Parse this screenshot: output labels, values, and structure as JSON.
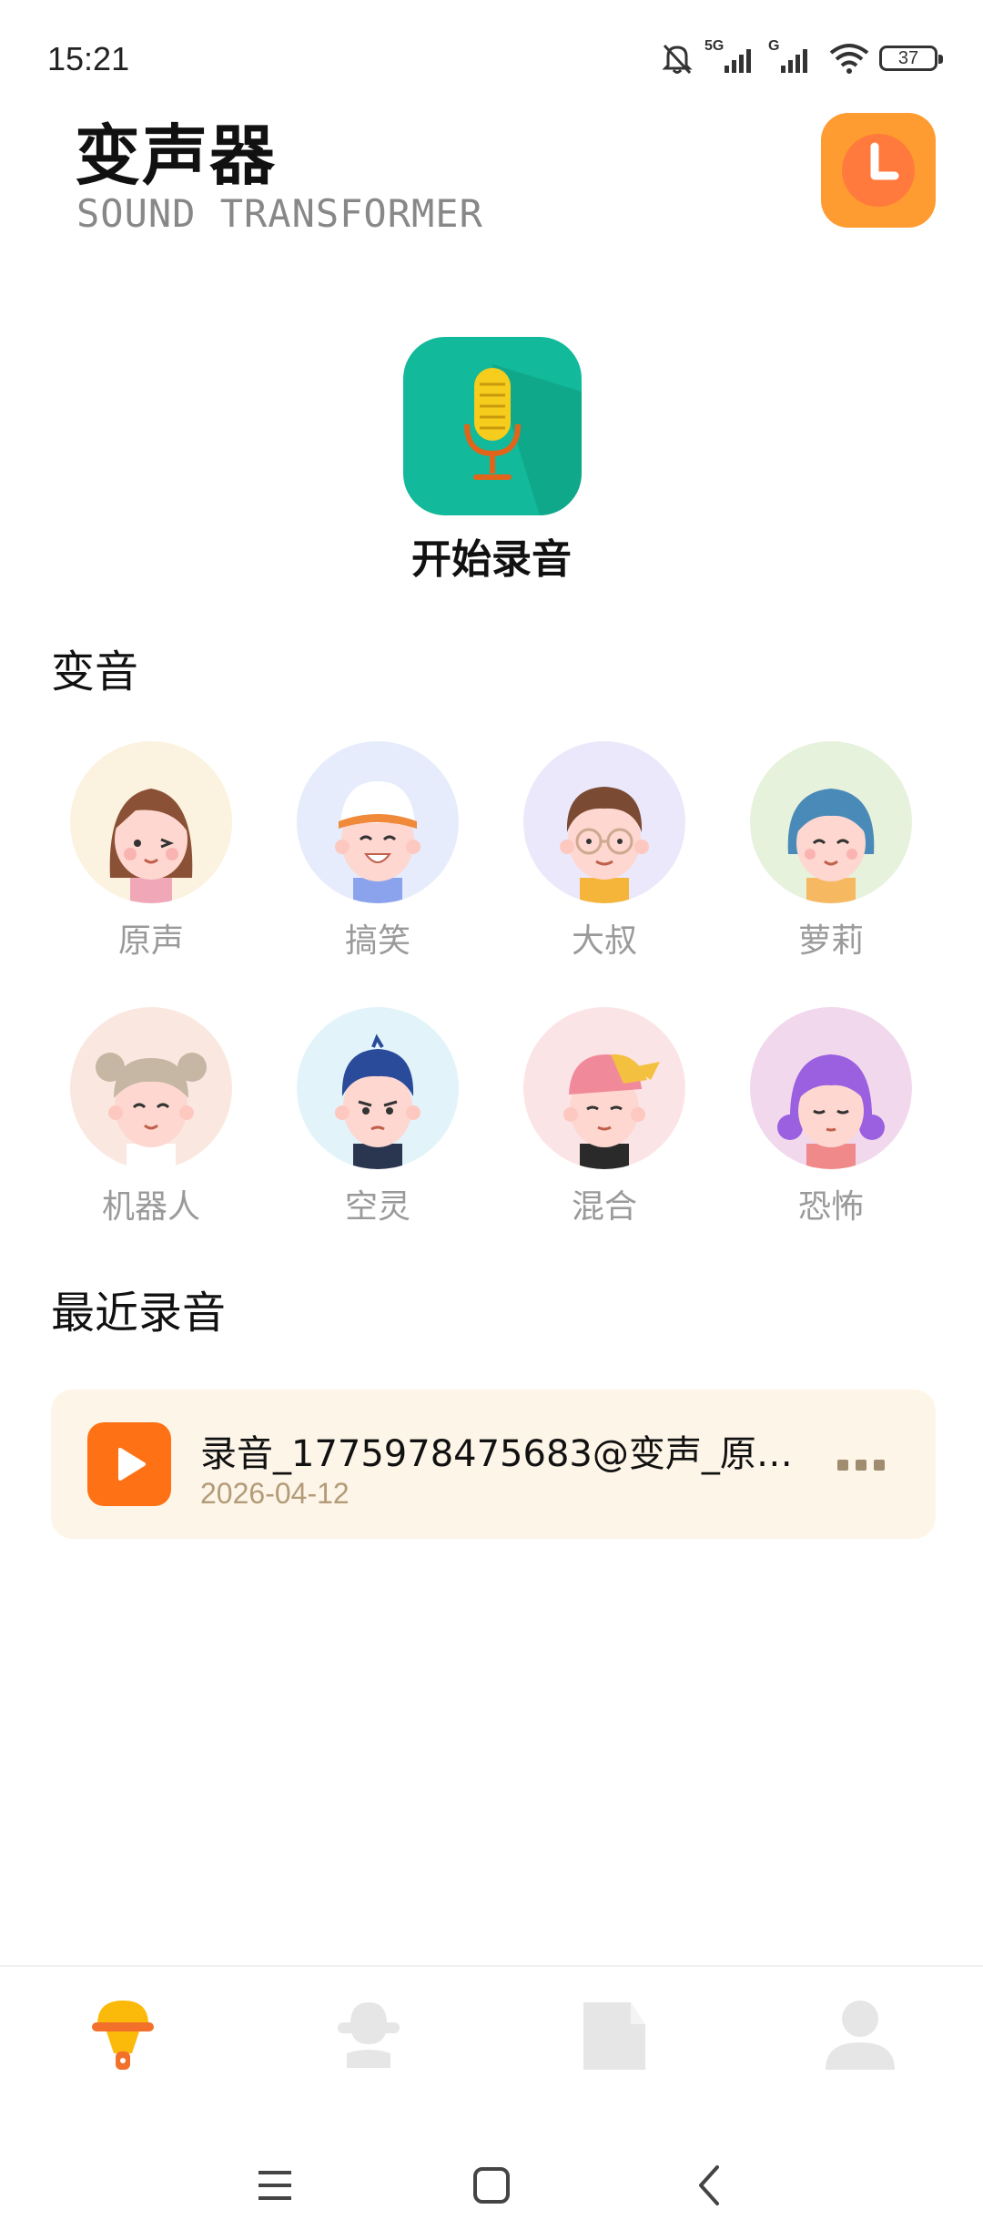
{
  "status_bar": {
    "time": "15:21",
    "signal1": "5G",
    "signal2": "G",
    "battery": "37"
  },
  "header": {
    "title": "变声器",
    "subtitle": "SOUND TRANSFORMER",
    "history_icon": "clock-icon"
  },
  "record": {
    "label": "开始录音",
    "icon": "microphone-icon"
  },
  "voices_section": {
    "title": "变音",
    "items": [
      {
        "label": "原声",
        "bg": "#fbf2df"
      },
      {
        "label": "搞笑",
        "bg": "#e6ecfb"
      },
      {
        "label": "大叔",
        "bg": "#ece8fb"
      },
      {
        "label": "萝莉",
        "bg": "#e6f2dc"
      },
      {
        "label": "机器人",
        "bg": "#fae8e0"
      },
      {
        "label": "空灵",
        "bg": "#e2f4fa"
      },
      {
        "label": "混合",
        "bg": "#fbe4e6"
      },
      {
        "label": "恐怖",
        "bg": "#f1d8ec"
      }
    ]
  },
  "recent_section": {
    "title": "最近录音",
    "items": [
      {
        "name": "录音_1775978475683@变声_原…",
        "date": "2026-04-12",
        "play_icon": "play-icon",
        "more_icon": "more-icon"
      }
    ]
  },
  "tabbar": {
    "tabs": [
      {
        "icon": "mic-tab-icon",
        "active": true
      },
      {
        "icon": "voice-tab-icon",
        "active": false
      },
      {
        "icon": "document-tab-icon",
        "active": false
      },
      {
        "icon": "profile-tab-icon",
        "active": false
      }
    ]
  },
  "navbar": {
    "menu_icon": "menu-icon",
    "home_icon": "home-icon",
    "back_icon": "back-icon"
  },
  "colors": {
    "accent_orange": "#fe7215",
    "history_orange": "#fe9c31",
    "record_teal": "#12b99a",
    "card_bg": "#fdf5e8"
  }
}
